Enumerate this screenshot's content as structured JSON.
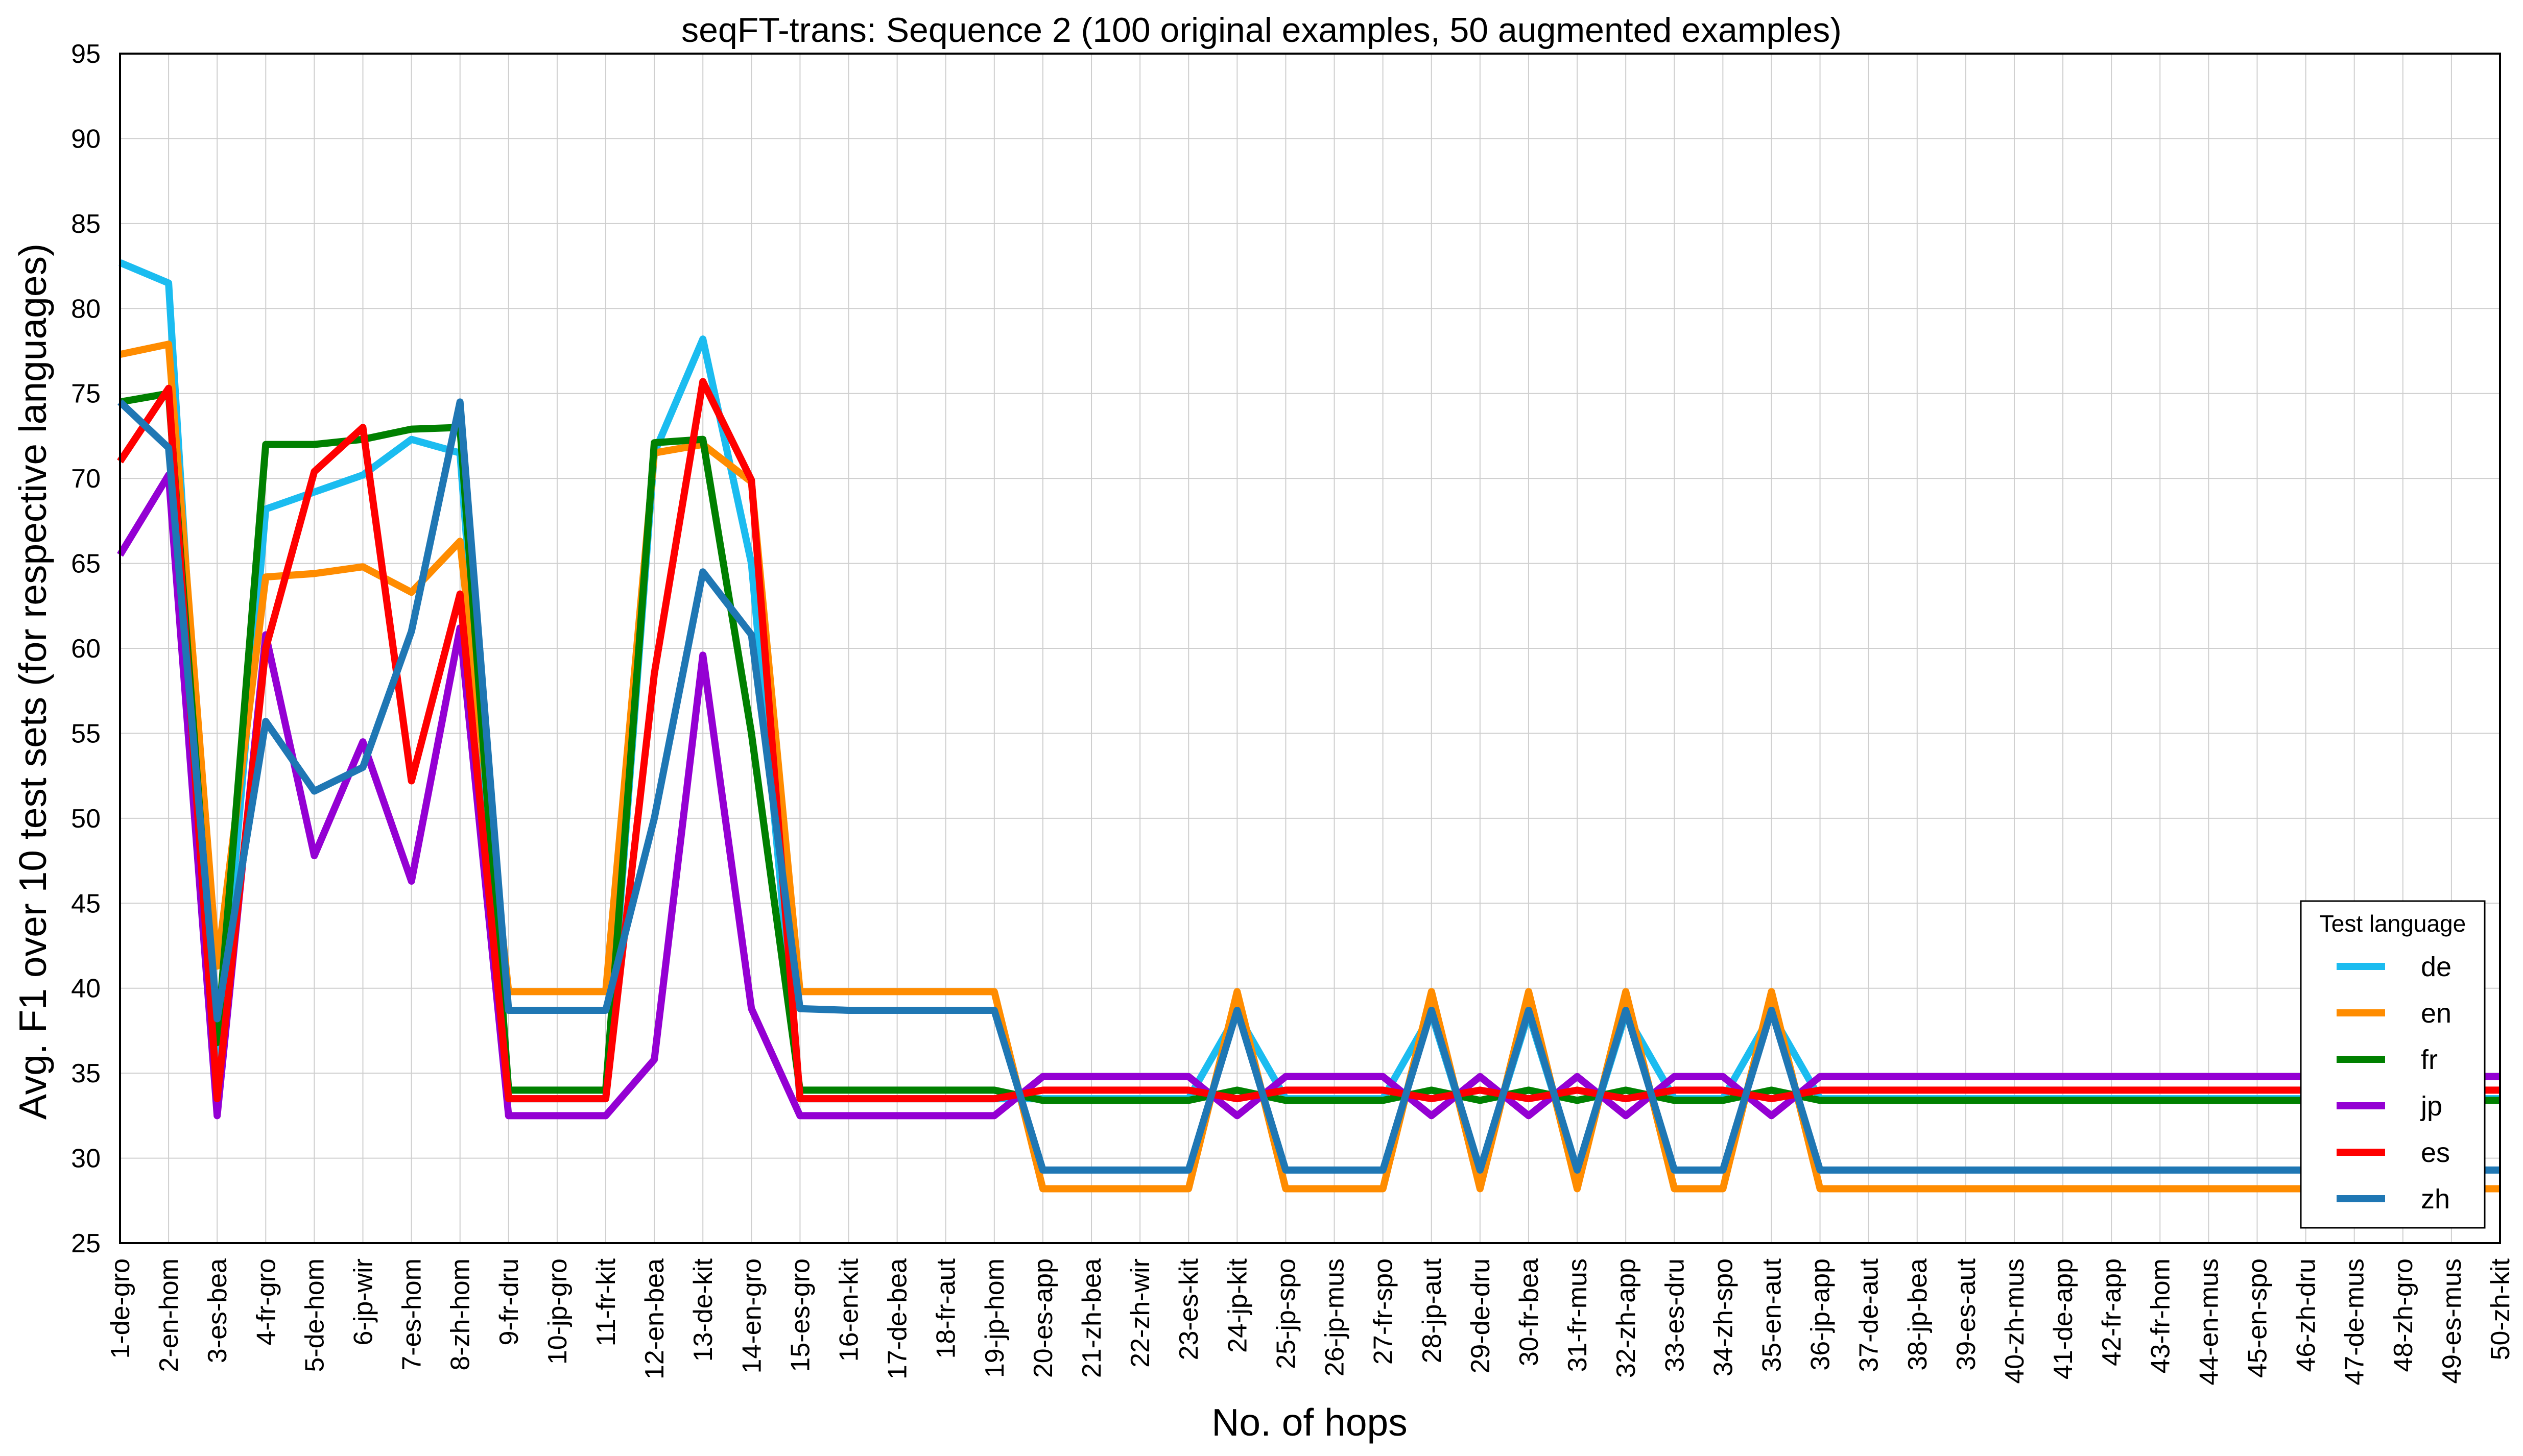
{
  "chart_data": {
    "type": "line",
    "title": "seqFT-trans: Sequence 2 (100 original examples, 50 augmented examples)",
    "xlabel": "No. of hops",
    "ylabel": "Avg. F1 over 10 test sets (for respective languages)",
    "ylim": [
      25,
      95
    ],
    "yticks": [
      25,
      30,
      35,
      40,
      45,
      50,
      55,
      60,
      65,
      70,
      75,
      80,
      85,
      90,
      95
    ],
    "grid": true,
    "legend": {
      "title": "Test language",
      "placement": "lower-right"
    },
    "categories": [
      "1-de-gro",
      "2-en-hom",
      "3-es-bea",
      "4-fr-gro",
      "5-de-hom",
      "6-jp-wir",
      "7-es-hom",
      "8-zh-hom",
      "9-fr-dru",
      "10-jp-gro",
      "11-fr-kit",
      "12-en-bea",
      "13-de-kit",
      "14-en-gro",
      "15-es-gro",
      "16-en-kit",
      "17-de-bea",
      "18-fr-aut",
      "19-jp-hom",
      "20-es-app",
      "21-zh-bea",
      "22-zh-wir",
      "23-es-kit",
      "24-jp-kit",
      "25-jp-spo",
      "26-jp-mus",
      "27-fr-spo",
      "28-jp-aut",
      "29-de-dru",
      "30-fr-bea",
      "31-fr-mus",
      "32-zh-app",
      "33-es-dru",
      "34-zh-spo",
      "35-en-aut",
      "36-jp-app",
      "37-de-aut",
      "38-jp-bea",
      "39-es-aut",
      "40-zh-mus",
      "41-de-app",
      "42-fr-app",
      "43-fr-hom",
      "44-en-mus",
      "45-en-spo",
      "46-zh-dru",
      "47-de-mus",
      "48-zh-gro",
      "49-es-mus",
      "50-zh-kit"
    ],
    "series": [
      {
        "name": "de",
        "color": "#1bbcf0",
        "values": [
          82.7,
          81.5,
          35.0,
          68.2,
          69.2,
          70.2,
          72.3,
          71.5,
          33.5,
          33.5,
          33.5,
          71.5,
          78.2,
          65.0,
          33.5,
          33.5,
          33.5,
          33.5,
          33.5,
          33.5,
          33.5,
          33.5,
          33.5,
          38.5,
          33.5,
          33.5,
          33.5,
          38.5,
          29.3,
          38.5,
          29.3,
          38.5,
          33.5,
          33.5,
          38.5,
          33.5,
          33.5,
          33.5,
          33.5,
          33.5,
          33.5,
          33.5,
          33.5,
          33.5,
          33.5,
          33.5,
          33.5,
          33.5,
          33.5,
          33.5
        ]
      },
      {
        "name": "en",
        "color": "#ff8c00",
        "values": [
          77.3,
          77.9,
          41.3,
          64.2,
          64.4,
          64.8,
          63.3,
          66.3,
          39.8,
          39.8,
          39.8,
          71.5,
          72.0,
          69.8,
          39.8,
          39.8,
          39.8,
          39.8,
          39.8,
          28.2,
          28.2,
          28.2,
          28.2,
          39.8,
          28.2,
          28.2,
          28.2,
          39.8,
          28.2,
          39.8,
          28.2,
          39.8,
          28.2,
          28.2,
          39.8,
          28.2,
          28.2,
          28.2,
          28.2,
          28.2,
          28.2,
          28.2,
          28.2,
          28.2,
          28.2,
          28.2,
          28.2,
          28.2,
          28.2,
          28.2
        ]
      },
      {
        "name": "fr",
        "color": "#008000",
        "values": [
          74.5,
          75.0,
          36.8,
          72.0,
          72.0,
          72.3,
          72.9,
          73.0,
          34.0,
          34.0,
          34.0,
          72.1,
          72.3,
          55.0,
          34.0,
          34.0,
          34.0,
          34.0,
          34.0,
          33.4,
          33.4,
          33.4,
          33.4,
          34.0,
          33.4,
          33.4,
          33.4,
          34.0,
          33.4,
          34.0,
          33.4,
          34.0,
          33.4,
          33.4,
          34.0,
          33.4,
          33.4,
          33.4,
          33.4,
          33.4,
          33.4,
          33.4,
          33.4,
          33.4,
          33.4,
          33.4,
          33.4,
          33.4,
          33.4,
          33.4
        ]
      },
      {
        "name": "jp",
        "color": "#9400d3",
        "values": [
          65.5,
          70.2,
          32.5,
          60.8,
          47.8,
          54.5,
          46.3,
          61.2,
          32.5,
          32.5,
          32.5,
          35.8,
          59.6,
          38.8,
          32.5,
          32.5,
          32.5,
          32.5,
          32.5,
          34.8,
          34.8,
          34.8,
          34.8,
          32.5,
          34.8,
          34.8,
          34.8,
          32.5,
          34.8,
          32.5,
          34.8,
          32.5,
          34.8,
          34.8,
          32.5,
          34.8,
          34.8,
          34.8,
          34.8,
          34.8,
          34.8,
          34.8,
          34.8,
          34.8,
          34.8,
          34.8,
          34.8,
          34.8,
          34.8,
          34.8
        ]
      },
      {
        "name": "es",
        "color": "#ff0000",
        "values": [
          71.0,
          75.3,
          33.5,
          60.0,
          70.4,
          73.0,
          52.2,
          63.2,
          33.5,
          33.5,
          33.5,
          58.5,
          75.7,
          69.9,
          33.5,
          33.5,
          33.5,
          33.5,
          33.5,
          34.0,
          34.0,
          34.0,
          34.0,
          33.5,
          34.0,
          34.0,
          34.0,
          33.5,
          34.0,
          33.5,
          34.0,
          33.5,
          34.0,
          34.0,
          33.5,
          34.0,
          34.0,
          34.0,
          34.0,
          34.0,
          34.0,
          34.0,
          34.0,
          34.0,
          34.0,
          34.0,
          34.0,
          34.0,
          34.0,
          34.0
        ]
      },
      {
        "name": "zh",
        "color": "#1f77b4",
        "values": [
          74.5,
          71.8,
          38.2,
          55.7,
          51.6,
          53.0,
          61.0,
          74.5,
          38.7,
          38.7,
          38.7,
          50.0,
          64.5,
          60.8,
          38.8,
          38.7,
          38.7,
          38.7,
          38.7,
          29.3,
          29.3,
          29.3,
          29.3,
          38.7,
          29.3,
          29.3,
          29.3,
          38.7,
          29.3,
          38.7,
          29.3,
          38.7,
          29.3,
          29.3,
          38.7,
          29.3,
          29.3,
          29.3,
          29.3,
          29.3,
          29.3,
          29.3,
          29.3,
          29.3,
          29.3,
          29.3,
          29.3,
          29.3,
          29.3,
          29.3
        ]
      }
    ]
  }
}
